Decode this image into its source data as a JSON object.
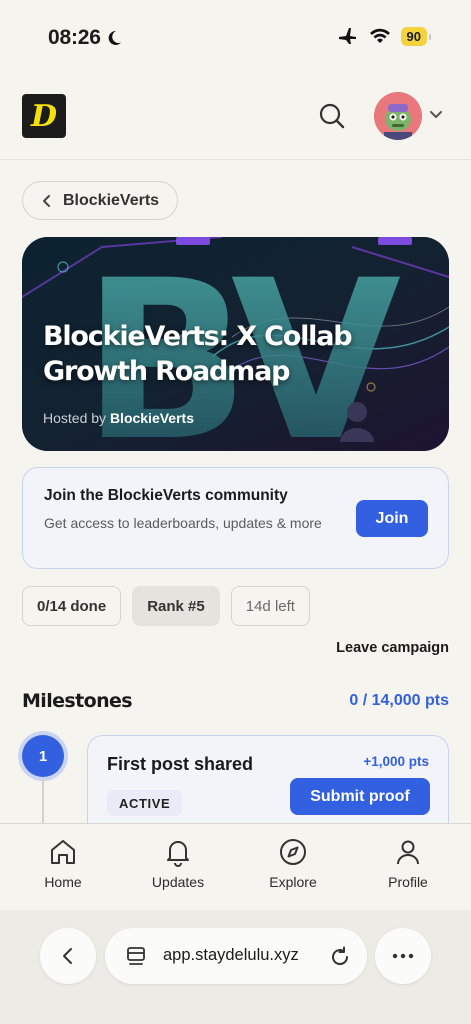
{
  "status_bar": {
    "time": "08:26",
    "battery": "90"
  },
  "header": {
    "logo_letter": "D"
  },
  "back": {
    "label": "BlockieVerts"
  },
  "hero": {
    "title": "BlockieVerts: X Collab Growth Roadmap",
    "host_prefix": "Hosted by",
    "host_name": "BlockieVerts",
    "art_letters": "BV"
  },
  "join_card": {
    "title": "Join the BlockieVerts community",
    "description": "Get access to leaderboards, updates & more",
    "button": "Join"
  },
  "stats": {
    "done": "0/14 done",
    "rank": "Rank #5",
    "left": "14d left"
  },
  "leave_label": "Leave campaign",
  "milestones": {
    "title": "Milestones",
    "points": "0 / 14,000 pts",
    "items": [
      {
        "number": "1",
        "name": "First post shared",
        "reward": "+1,000 pts",
        "status": "ACTIVE",
        "action": "Submit proof"
      }
    ]
  },
  "bottom_nav": {
    "items": [
      {
        "label": "Home",
        "icon": "home-icon"
      },
      {
        "label": "Updates",
        "icon": "bell-icon"
      },
      {
        "label": "Explore",
        "icon": "compass-icon"
      },
      {
        "label": "Profile",
        "icon": "person-icon"
      }
    ]
  },
  "browser": {
    "url": "app.staydelulu.xyz"
  },
  "colors": {
    "accent": "#3360e0",
    "background": "#f5f4ef",
    "battery": "#f4d23e"
  }
}
